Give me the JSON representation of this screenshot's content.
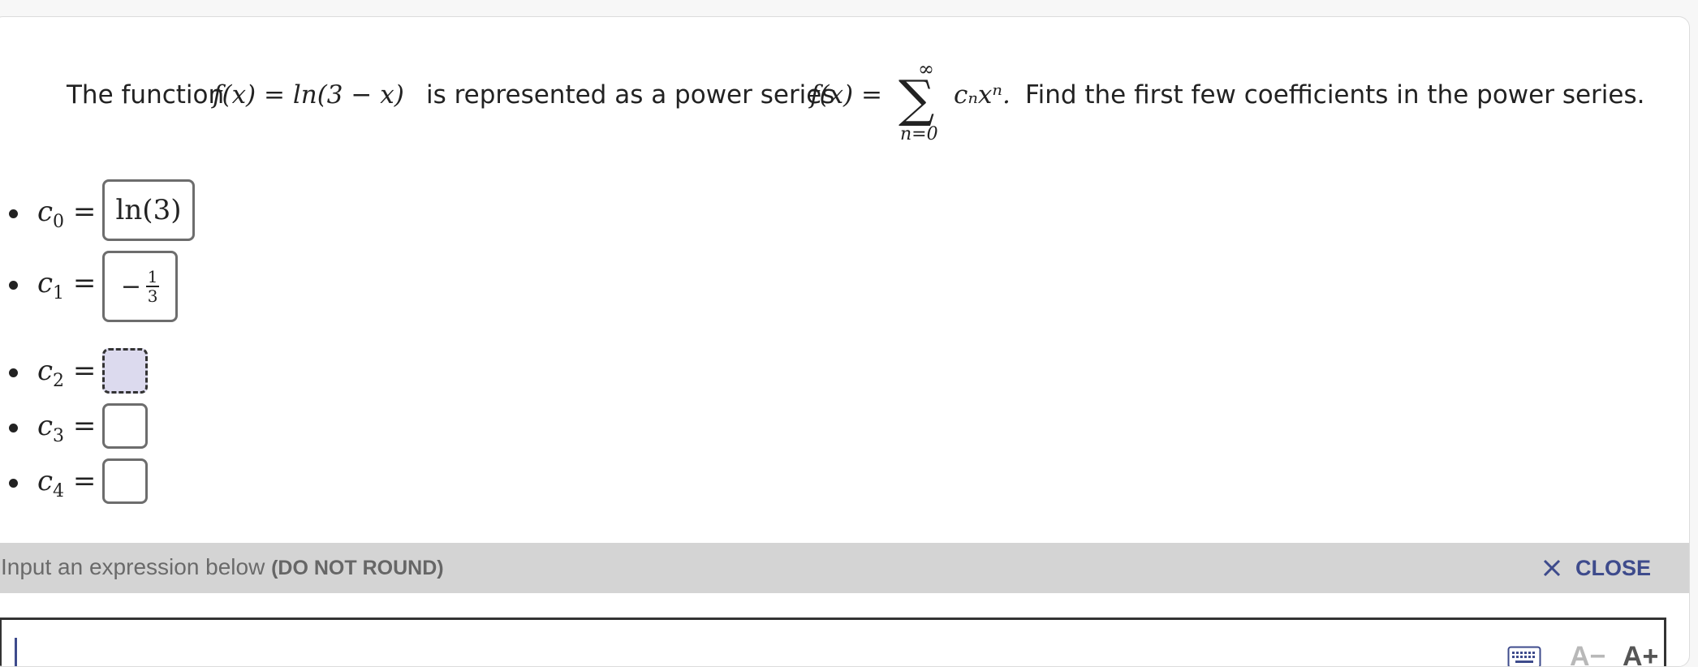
{
  "question": {
    "intro": "The function",
    "f_lhs": "f(x) = ln(3 − x)",
    "mid": "is represented as a power series",
    "f_rhs": "f(x) =",
    "sum_upper": "∞",
    "sum_symbol": "∑",
    "sum_lower": "n=0",
    "term": "cₙxⁿ.",
    "tail": "Find the first few coefficients in the power series."
  },
  "answers": [
    {
      "label": "c",
      "sub": "0",
      "eq": "=",
      "value": "ln(3)",
      "state": "filled"
    },
    {
      "label": "c",
      "sub": "1",
      "eq": "=",
      "value_sign": "−",
      "value_num": "1",
      "value_den": "3",
      "state": "filled"
    },
    {
      "label": "c",
      "sub": "2",
      "eq": "=",
      "value": "",
      "state": "active"
    },
    {
      "label": "c",
      "sub": "3",
      "eq": "=",
      "value": "",
      "state": "empty"
    },
    {
      "label": "c",
      "sub": "4",
      "eq": "=",
      "value": "",
      "state": "empty"
    }
  ],
  "toolbar": {
    "hint": "Input an expression below",
    "hint_bold": "(DO NOT ROUND)",
    "close_label": "CLOSE",
    "close_icon": "close-x-icon"
  },
  "editor": {
    "value": "",
    "keyboard_icon": "keyboard-icon",
    "font_decrease": "A−",
    "font_increase": "A+"
  },
  "colors": {
    "accent": "#3e4b8c",
    "active_fill": "#dcdaee",
    "toolbar_bg": "#d4d4d4"
  }
}
